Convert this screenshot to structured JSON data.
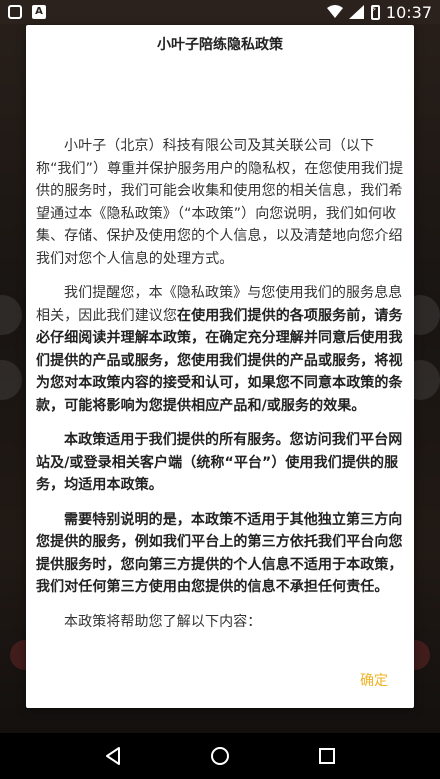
{
  "status_bar": {
    "time": "10:37",
    "icons": [
      "notification-square-icon",
      "a-notification-icon",
      "wifi-icon",
      "signal-icon",
      "battery-charging-icon"
    ]
  },
  "dialog": {
    "title": "小叶子陪练隐私政策",
    "paragraphs": [
      {
        "segments": [
          {
            "text": "小叶子（北京）科技有限公司及其关联公司（以下称“我们”）尊重并保护服务用户的隐私权，在您使用我们提供的服务时，我们可能会收集和使用您的相关信息，我们希望通过本《隐私政策》（“本政策”）向您说明，我们如何收集、存储、保护及使用您的个人信息，以及清楚地向您介绍我们对您个人信息的处理方式。",
            "bold": false
          }
        ]
      },
      {
        "segments": [
          {
            "text": "我们提醒您，本《隐私政策》与您使用我们的服务息息相关，因此我们建议您",
            "bold": false
          },
          {
            "text": "在使用我们提供的各项服务前，请务必仔细阅读并理解本政策，在确定充分理解并同意后使用我们提供的产品或服务，您使用我们提供的产品或服务，将视为您对本政策内容的接受和认可，如果您不同意本政策的条款，可能将影响为您提供相应产品和/或服务的效果。",
            "bold": true
          }
        ]
      },
      {
        "segments": [
          {
            "text": "本政策适用于我们提供的所有服务。您访问我们平台网站及/或登录相关客户端（统称“平台”）使用我们提供的服务，均适用本政策。",
            "bold": true
          }
        ]
      },
      {
        "segments": [
          {
            "text": "需要特别说明的是，本政策不适用于其他独立第三方向您提供的服务，例如我们平台上的第三方依托我们平台向您提供服务时，您向第三方提供的个人信息不适用于本政策，我们对任何第三方使用由您提供的信息不承担任何责任。",
            "bold": true
          }
        ]
      },
      {
        "segments": [
          {
            "text": "本政策将帮助您了解以下内容：",
            "bold": false
          }
        ]
      }
    ],
    "confirm_label": "确定"
  },
  "nav_bar": {
    "buttons": [
      "back-icon",
      "home-icon",
      "recents-icon"
    ]
  },
  "colors": {
    "accent": "#f0b323",
    "status_bar_bg": "#2b221d",
    "nav_bar_bg": "#000000"
  }
}
